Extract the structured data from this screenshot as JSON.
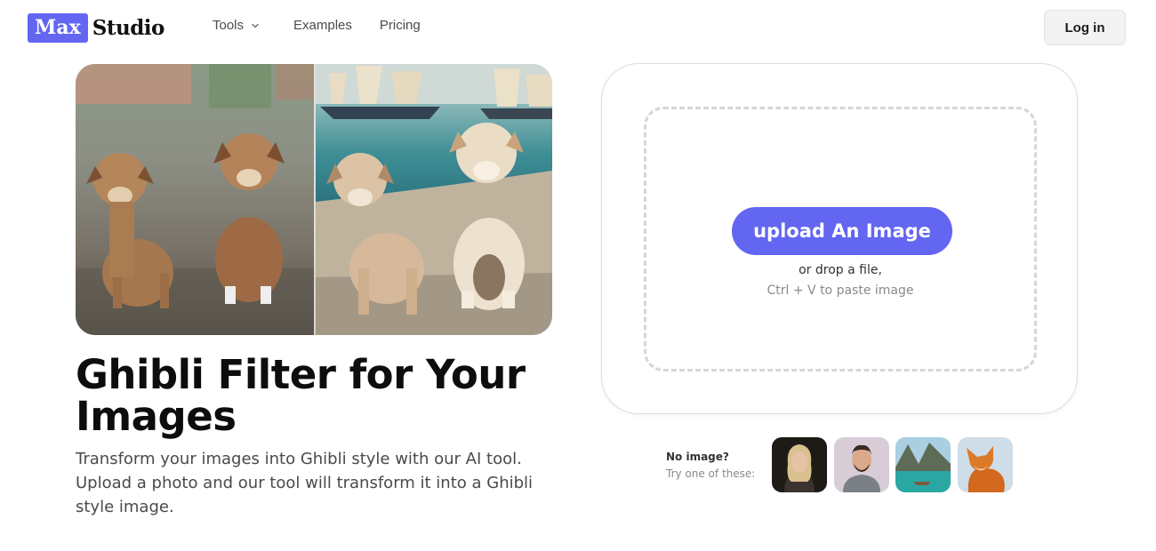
{
  "brand": {
    "box": "Max",
    "text": "Studio"
  },
  "nav": {
    "tools": "Tools",
    "examples": "Examples",
    "pricing": "Pricing"
  },
  "header": {
    "login": "Log in"
  },
  "hero": {
    "title": "Ghibli Filter for Your Images",
    "description": "Transform your images into Ghibli style with our AI tool. Upload a photo and our tool will transform it into a Ghibli style image."
  },
  "upload": {
    "button": "upload An Image",
    "drop": "or drop a file,",
    "paste": "Ctrl + V to paste image"
  },
  "samples": {
    "line1": "No image?",
    "line2": "Try one of these:",
    "items": [
      "woman-portrait",
      "man-portrait",
      "mountain-lake",
      "fox"
    ]
  },
  "colors": {
    "accent": "#6366f1"
  }
}
